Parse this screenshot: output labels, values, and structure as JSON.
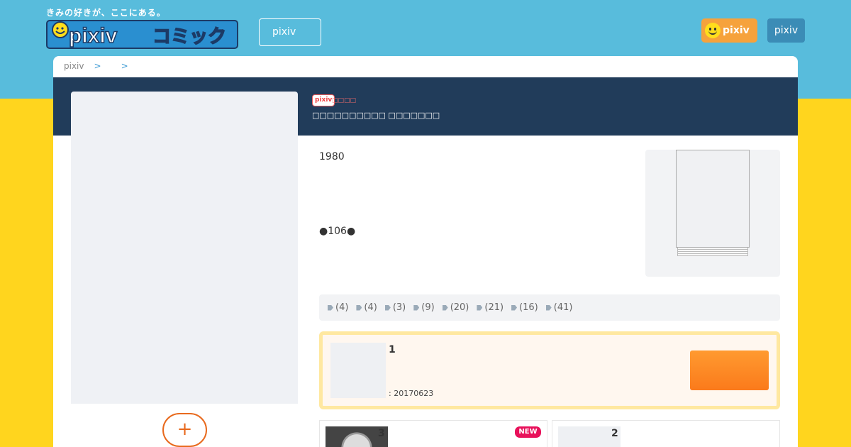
{
  "header": {
    "tagline": "きみの好きが、ここにある。",
    "logo_text": "pixivコミック",
    "search_placeholder": "pixiv",
    "pixiv_button": "pixiv",
    "login_button": "pixiv"
  },
  "breadcrumb": {
    "items": [
      "pixiv",
      "",
      ""
    ],
    "separator": ">"
  },
  "work": {
    "publisher_badge": "pixiv",
    "publisher_name": "□□□□",
    "title_line": "□□□□□□□□□□ □□□□□□□",
    "description_1": "1980",
    "description_2": "●106●"
  },
  "tags": [
    {
      "label": "(4)"
    },
    {
      "label": "(4)"
    },
    {
      "label": "(3)"
    },
    {
      "label": "(9)"
    },
    {
      "label": "(20)"
    },
    {
      "label": "(21)"
    },
    {
      "label": "(16)"
    },
    {
      "label": "(41)"
    }
  ],
  "first_episode": {
    "number": "1",
    "date": ": 20170623"
  },
  "episodes": [
    {
      "number": "3",
      "badge": "NEW"
    },
    {
      "number": "2"
    }
  ],
  "follow": {
    "icon": "+"
  },
  "colors": {
    "header_bg": "#58bcdc",
    "page_bg": "#ffd51e",
    "navy": "#213c5a",
    "accent_orange": "#fb7a1b",
    "new_badge": "#e8115a"
  }
}
